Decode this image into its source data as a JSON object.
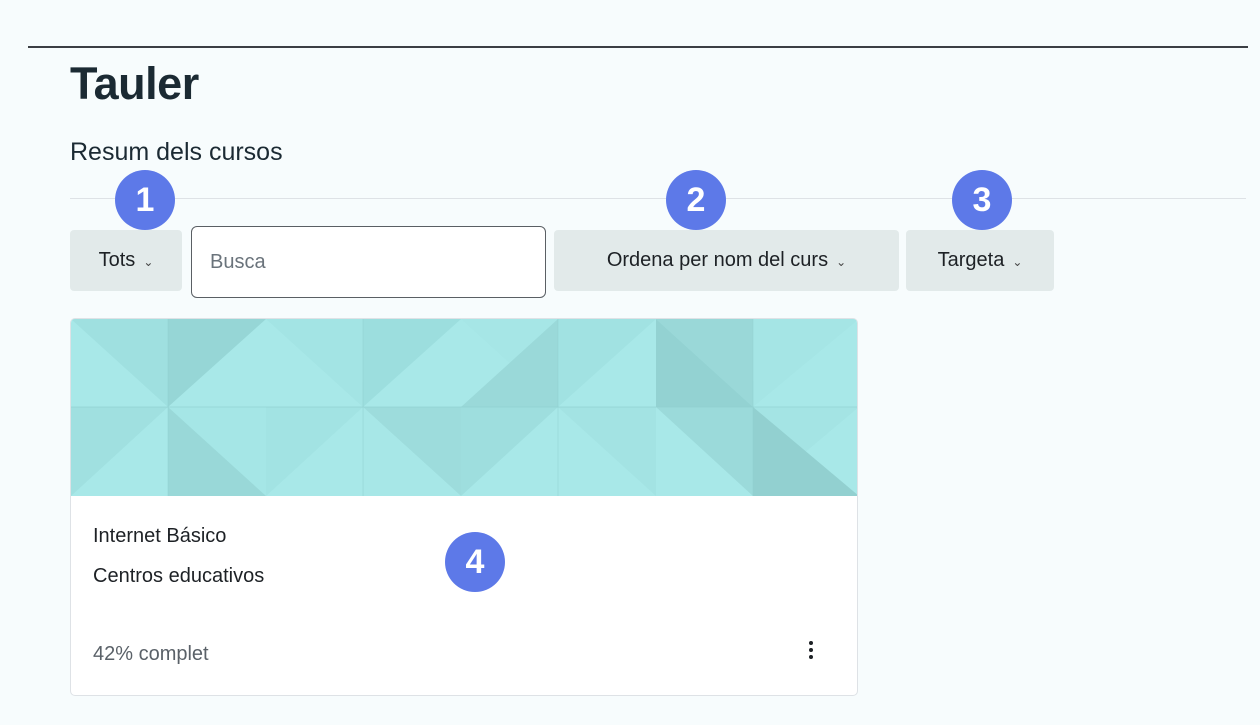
{
  "header": {
    "title": "Tauler"
  },
  "block": {
    "title": "Resum dels cursos"
  },
  "controls": {
    "filter_label": "Tots",
    "search_placeholder": "Busca",
    "sort_label": "Ordena per nom del curs",
    "view_label": "Targeta"
  },
  "annotations": [
    "1",
    "2",
    "3",
    "4"
  ],
  "course": {
    "name": "Internet Básico",
    "category": "Centros educativos",
    "progress_text": "42% complet",
    "progress": 42
  },
  "colors": {
    "badge": "#5d79e8",
    "card_pattern_base": "#a8e8e8",
    "button_bg": "#e2eaea"
  }
}
